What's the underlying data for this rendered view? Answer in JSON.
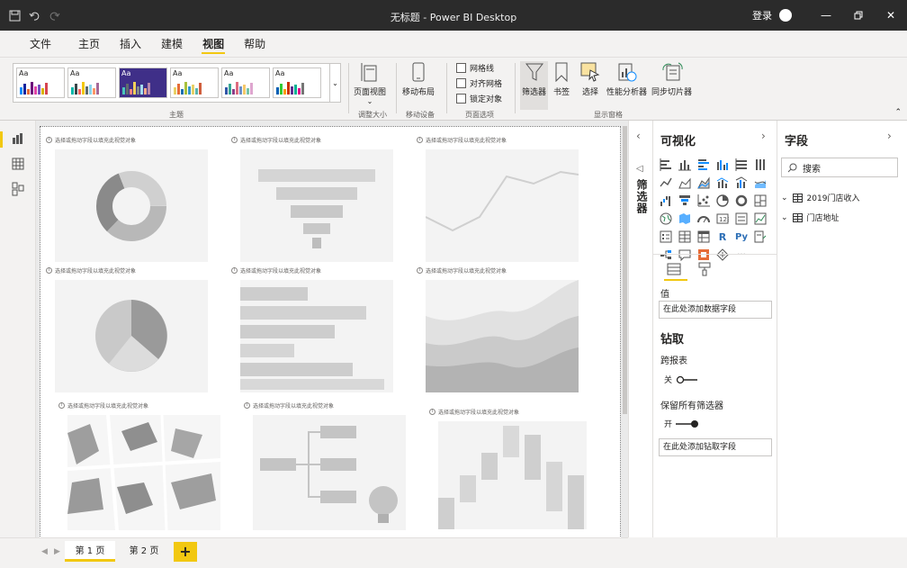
{
  "window": {
    "title": "无标题 - Power BI Desktop",
    "signin": "登录",
    "icons": [
      "save-icon",
      "undo-icon",
      "redo-icon",
      "minimize-icon",
      "restore-icon",
      "close-icon"
    ]
  },
  "menu": [
    "文件",
    "主页",
    "插入",
    "建模",
    "视图",
    "帮助"
  ],
  "menu_active": "视图",
  "ribbon": {
    "groups": {
      "themes": "主题",
      "scale": "调整大小",
      "mobile": "移动设备",
      "page_options": "页面选项",
      "show_panes": "显示窗格"
    },
    "theme_thumbs": [
      "Aa",
      "Aa",
      "Aa",
      "Aa",
      "Aa",
      "Aa"
    ],
    "page_view": "页面视图",
    "mobile_layout": "移动布局",
    "checks": [
      "网格线",
      "对齐网格",
      "锁定对象"
    ],
    "panes": [
      "筛选器",
      "书签",
      "选择",
      "性能分析器",
      "同步切片器"
    ]
  },
  "visual_caption": "选择或拖动字段以填充此视觉对象",
  "filters_pane": {
    "label": "筛选器"
  },
  "viz_pane": {
    "title": "可视化",
    "values_label": "值",
    "values_drop": "在此处添加数据字段",
    "drill_head": "钻取",
    "cross_report": "跨报表",
    "cross_state": "关",
    "keep_filters": "保留所有筛选器",
    "keep_state": "开",
    "drill_drop": "在此处添加钻取字段",
    "r_label": "R",
    "py_label": "Py",
    "more": "···"
  },
  "fields_pane": {
    "title": "字段",
    "search": "搜索",
    "tables": [
      "2019门店收入",
      "门店地址"
    ]
  },
  "pages": [
    "第 1 页",
    "第 2 页"
  ],
  "active_page": "第 1 页",
  "colors": {
    "accent": "#f2c811",
    "titlebar": "#2b2b2b",
    "placeholder": "#f3f3f3"
  }
}
